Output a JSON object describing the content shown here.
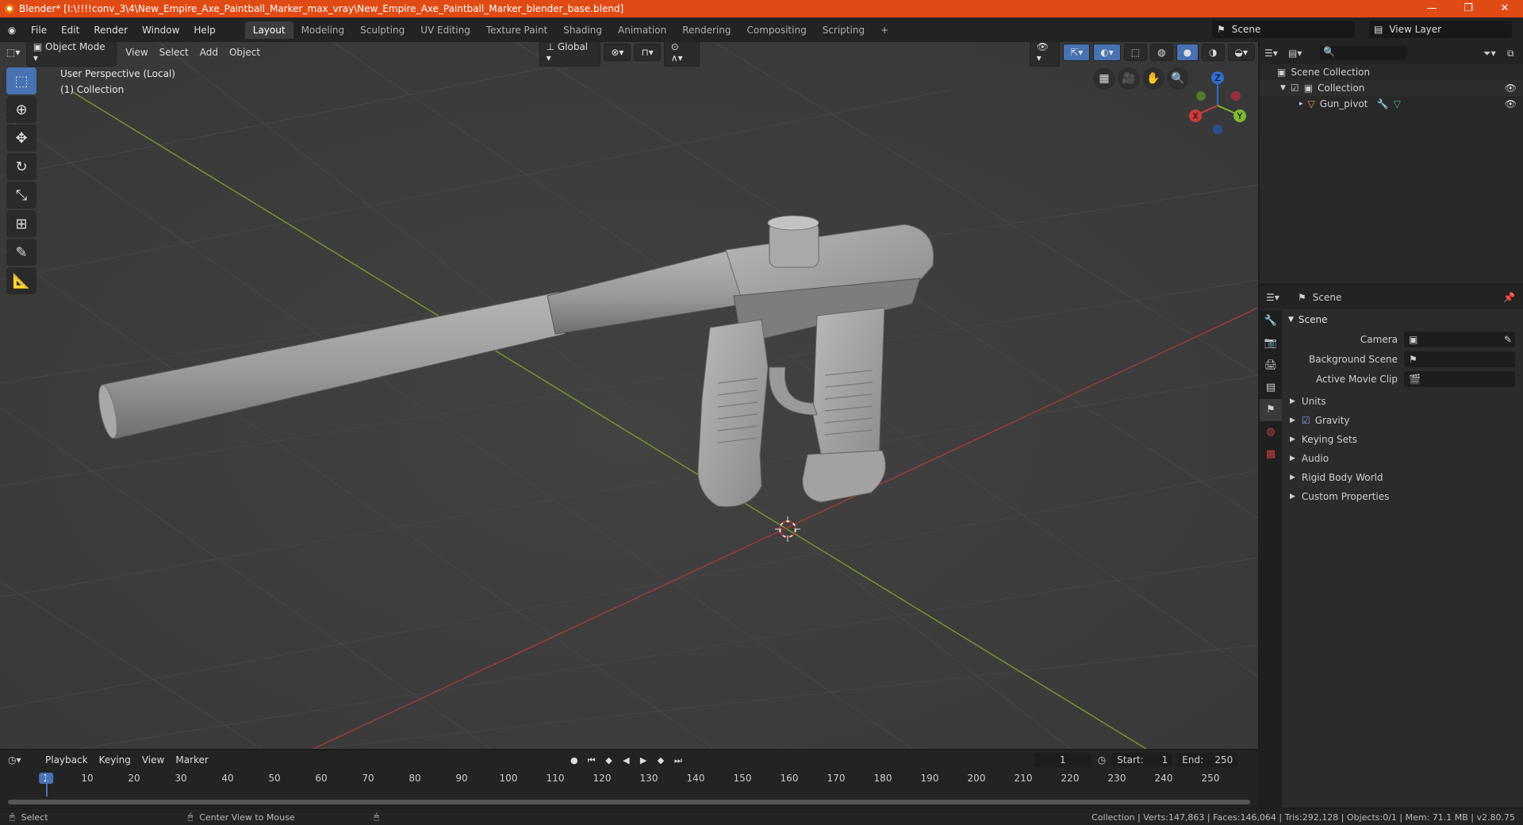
{
  "window": {
    "title": "Blender* [I:\\!!!!conv_3\\4\\New_Empire_Axe_Paintball_Marker_max_vray\\New_Empire_Axe_Paintball_Marker_blender_base.blend]",
    "minimize": "—",
    "maximize": "❐",
    "close": "✕"
  },
  "menu": [
    "File",
    "Edit",
    "Render",
    "Window",
    "Help"
  ],
  "workspaces": [
    "Layout",
    "Modeling",
    "Sculpting",
    "UV Editing",
    "Texture Paint",
    "Shading",
    "Animation",
    "Rendering",
    "Compositing",
    "Scripting"
  ],
  "add_workspace": "+",
  "scene": {
    "label": "Scene",
    "view_layer": "View Layer"
  },
  "viewport": {
    "mode": "Object Mode",
    "menus": [
      "View",
      "Select",
      "Add",
      "Object"
    ],
    "orientation": "Global",
    "perspective": "User Perspective (Local)",
    "collection": "(1) Collection",
    "gizmo": {
      "x": "X",
      "y": "Y",
      "z": "Z"
    }
  },
  "tools": [
    "select-box-icon",
    "cursor-icon",
    "move-icon",
    "rotate-icon",
    "scale-icon",
    "transform-icon",
    "annotate-icon",
    "measure-icon"
  ],
  "outliner": {
    "root": "Scene Collection",
    "items": [
      {
        "name": "Collection",
        "depth": 1
      },
      {
        "name": "Gun_pivot",
        "depth": 2
      }
    ]
  },
  "properties": {
    "header": "Scene",
    "panel": "Scene",
    "fields": [
      {
        "label": "Camera",
        "value": ""
      },
      {
        "label": "Background Scene",
        "value": ""
      },
      {
        "label": "Active Movie Clip",
        "value": ""
      }
    ],
    "sections": [
      "Units",
      "Gravity",
      "Keying Sets",
      "Audio",
      "Rigid Body World",
      "Custom Properties"
    ]
  },
  "timeline": {
    "menus": [
      "Playback",
      "Keying",
      "View",
      "Marker"
    ],
    "current_frame": "1",
    "start_label": "Start:",
    "start": "1",
    "end_label": "End:",
    "end": "250",
    "ticks": [
      "1",
      "10",
      "20",
      "30",
      "40",
      "50",
      "60",
      "70",
      "80",
      "90",
      "100",
      "110",
      "120",
      "130",
      "140",
      "150",
      "160",
      "170",
      "180",
      "190",
      "200",
      "210",
      "220",
      "230",
      "240",
      "250"
    ]
  },
  "status": {
    "left": "Select",
    "middle": "Center View to Mouse",
    "right": "Collection | Verts:147,863 | Faces:146,064 | Tris:292,128 | Objects:0/1 | Mem: 71.1 MB | v2.80.75"
  }
}
